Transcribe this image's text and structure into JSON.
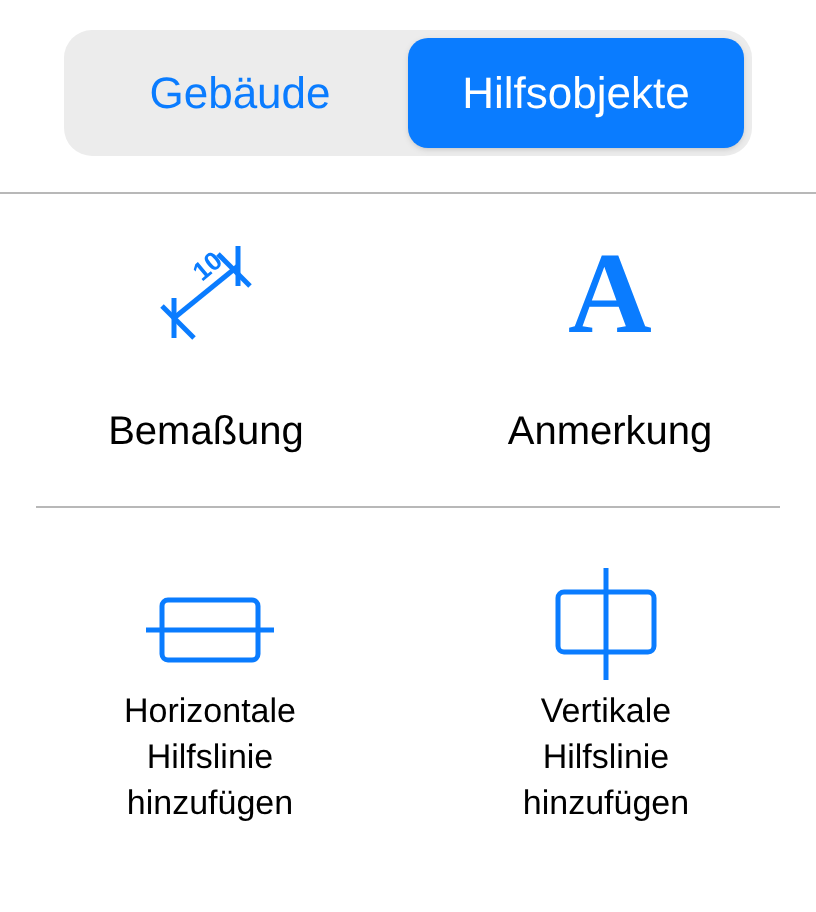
{
  "segmented_control": [
    {
      "label": "Gebäude",
      "selected": false
    },
    {
      "label": "Hilfsobjekte",
      "selected": true
    }
  ],
  "tools": [
    {
      "kind": "dimension",
      "label": "Bemaßung",
      "icon_text": "10"
    },
    {
      "kind": "annotation",
      "label": "Anmerkung",
      "icon_text": "A"
    }
  ],
  "guides": [
    {
      "kind": "horizontal",
      "label": "Horizontale Hilfslinie hinzufügen"
    },
    {
      "kind": "vertical",
      "label": "Vertikale Hilfslinie hinzufügen"
    }
  ]
}
